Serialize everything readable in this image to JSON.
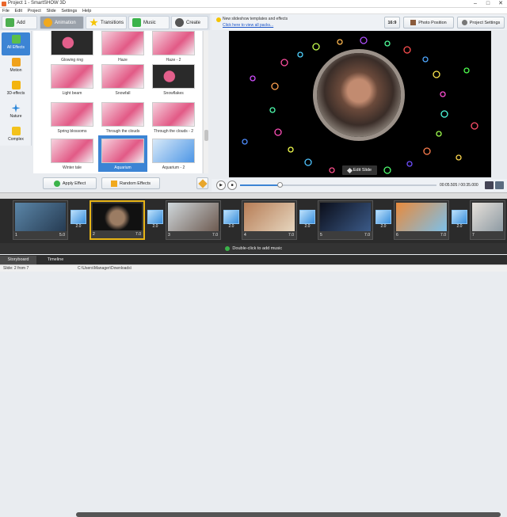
{
  "window": {
    "title": "Project 1 - SmartSHOW 3D",
    "minimize": "–",
    "maximize": "□",
    "close": "✕"
  },
  "menu": [
    "File",
    "Edit",
    "Project",
    "Slide",
    "Settings",
    "Help"
  ],
  "tabs": [
    {
      "label": "Add",
      "icon": "add-icon",
      "color": "#4caf50"
    },
    {
      "label": "Animation",
      "icon": "animation-icon",
      "color": "#f1a91e"
    },
    {
      "label": "Transitions",
      "icon": "star-icon",
      "color": "#f5c400"
    },
    {
      "label": "Music",
      "icon": "music-icon",
      "color": "#3bb34a"
    },
    {
      "label": "Create",
      "icon": "create-icon",
      "color": "#555555"
    }
  ],
  "sidebar": [
    {
      "label": "All Effects",
      "icon": "all-effects-icon",
      "color": "#5bbf4a"
    },
    {
      "label": "Motion",
      "icon": "motion-icon",
      "color": "#f0a21c"
    },
    {
      "label": "3D-effects",
      "icon": "3d-effects-icon",
      "color": "#f3b40f"
    },
    {
      "label": "Nature",
      "icon": "nature-icon",
      "color": "#2a86d8"
    },
    {
      "label": "Complex",
      "icon": "complex-icon",
      "color": "#f3c21c"
    }
  ],
  "effects": [
    {
      "label": "Glowing ring",
      "style": "dark"
    },
    {
      "label": "Haze",
      "style": "pink"
    },
    {
      "label": "Haze - 2",
      "style": "pink"
    },
    {
      "label": "Light beam",
      "style": "pink"
    },
    {
      "label": "Snowfall",
      "style": "pink"
    },
    {
      "label": "Snowflakes",
      "style": "dark"
    },
    {
      "label": "Spring blossoms",
      "style": "pink"
    },
    {
      "label": "Through the clouds",
      "style": "pink"
    },
    {
      "label": "Through the clouds - 2",
      "style": "pink"
    },
    {
      "label": "Winter tale",
      "style": "pink"
    },
    {
      "label": "Aquarium",
      "style": "blue"
    },
    {
      "label": "Aquarium - 2",
      "style": "blue"
    }
  ],
  "actions": {
    "apply": "Apply Effect",
    "random": "Random Effects"
  },
  "preview_header": {
    "notice": "New slideshow templates and effects",
    "link": "Click here to view all packs...",
    "aspect": "16:9",
    "photo_position": "Photo Position",
    "project_settings": "Project Settings"
  },
  "edit_slide": "Edit Slide",
  "player": {
    "current_time": "00:05.505",
    "total_time": "00:35.000",
    "separator": "/",
    "progress": 0.2
  },
  "slides": [
    {
      "num": "1",
      "duration": "5.0",
      "img": "linear-gradient(135deg,#5b86a8,#263b52)"
    },
    {
      "num": "2",
      "duration": "7.0",
      "img": "radial-gradient(circle,#9b7c63 0 25%,#111 45%)"
    },
    {
      "num": "3",
      "duration": "7.0",
      "img": "linear-gradient(135deg,#cfd7db,#6d5a50)"
    },
    {
      "num": "4",
      "duration": "7.0",
      "img": "linear-gradient(135deg,#b77d56,#e6d6bf)"
    },
    {
      "num": "5",
      "duration": "7.0",
      "img": "linear-gradient(135deg,#0b0e1a,#3b5a88)"
    },
    {
      "num": "6",
      "duration": "7.0",
      "img": "linear-gradient(135deg,#e88a3c,#7cc0ea)"
    },
    {
      "num": "7",
      "duration": "",
      "img": "linear-gradient(135deg,#e7e1da,#8d9aa3)"
    }
  ],
  "transitions": [
    "2.0",
    "2.0",
    "2.0",
    "2.0",
    "2.0",
    "2.0"
  ],
  "music_hint": "Double-click to add music",
  "bottom_tabs": [
    "Storyboard",
    "Timeline"
  ],
  "status": {
    "slide": "Slide: 2 from 7",
    "path": "C:\\Users\\Manager\\Downloads\\"
  }
}
